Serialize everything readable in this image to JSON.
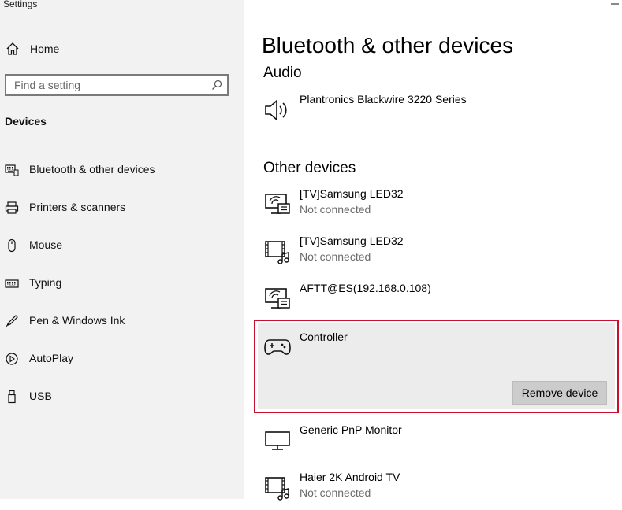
{
  "window": {
    "title": "Settings"
  },
  "sidebar": {
    "home_label": "Home",
    "search_placeholder": "Find a setting",
    "section_heading": "Devices",
    "items": [
      {
        "label": "Bluetooth & other devices",
        "icon": "bluetooth-keyboard-icon"
      },
      {
        "label": "Printers & scanners",
        "icon": "printer-icon"
      },
      {
        "label": "Mouse",
        "icon": "mouse-icon"
      },
      {
        "label": "Typing",
        "icon": "keyboard-icon"
      },
      {
        "label": "Pen & Windows Ink",
        "icon": "pen-icon"
      },
      {
        "label": "AutoPlay",
        "icon": "autoplay-icon"
      },
      {
        "label": "USB",
        "icon": "usb-icon"
      }
    ]
  },
  "main": {
    "title": "Bluetooth & other devices",
    "audio": {
      "heading": "Audio",
      "devices": [
        {
          "name": "Plantronics Blackwire 3220 Series",
          "status": "",
          "icon": "speaker-icon"
        }
      ]
    },
    "other": {
      "heading": "Other devices",
      "devices": [
        {
          "name": "[TV]Samsung LED32",
          "status": "Not connected",
          "icon": "media-renderer-icon"
        },
        {
          "name": "[TV]Samsung LED32",
          "status": "Not connected",
          "icon": "media-player-icon"
        },
        {
          "name": "AFTT@ES(192.168.0.108)",
          "status": "",
          "icon": "media-renderer-icon"
        },
        {
          "name": "Controller",
          "status": "",
          "icon": "gamepad-icon",
          "selected": true,
          "action_label": "Remove device"
        },
        {
          "name": "Generic PnP Monitor",
          "status": "",
          "icon": "monitor-icon"
        },
        {
          "name": "Haier 2K Android TV",
          "status": "Not connected",
          "icon": "media-player-icon"
        }
      ]
    }
  },
  "colors": {
    "sidebar_bg": "#f2f2f2",
    "selection_border": "#c8102e",
    "selected_bg": "#ececec",
    "button_bg": "#cccccc"
  }
}
